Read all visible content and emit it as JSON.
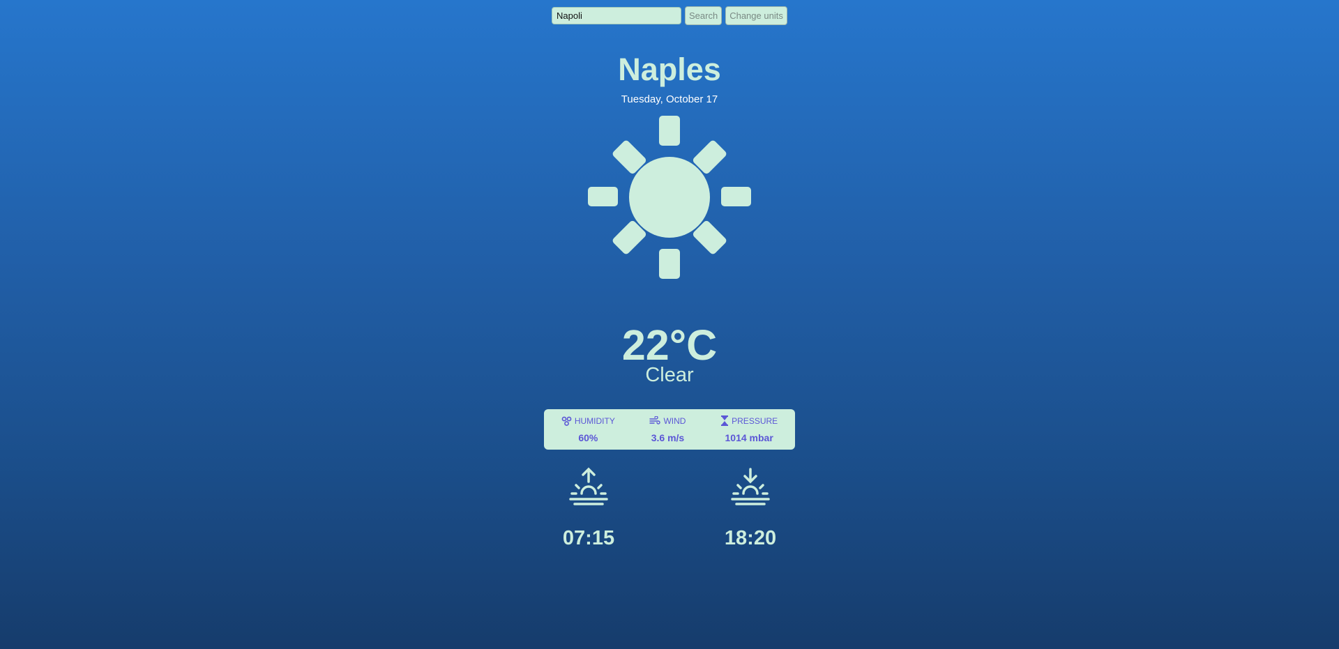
{
  "search": {
    "value": "Napoli",
    "search_label": "Search",
    "units_label": "Change units"
  },
  "location": {
    "city": "Naples",
    "date": "Tuesday, October 17"
  },
  "current": {
    "icon": "sun-icon",
    "temperature": "22°C",
    "condition": "Clear"
  },
  "stats": {
    "humidity": {
      "label": "HUMIDITY",
      "value": "60%",
      "icon": "humidity-icon"
    },
    "wind": {
      "label": "WIND",
      "value": "3.6 m/s",
      "icon": "wind-icon"
    },
    "pressure": {
      "label": "PRESSURE",
      "value": "1014 mbar",
      "icon": "pressure-icon"
    }
  },
  "sun": {
    "sunrise": {
      "time": "07:15",
      "icon": "sunrise-icon"
    },
    "sunset": {
      "time": "18:20",
      "icon": "sunset-icon"
    }
  },
  "colors": {
    "background_top": "#2676cc",
    "background_bottom": "#163c6c",
    "accent": "#cdeedd",
    "stat_text": "#5b56d6"
  }
}
